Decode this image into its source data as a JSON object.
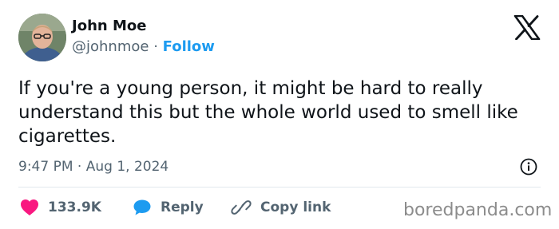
{
  "author": {
    "name": "John Moe",
    "handle": "@johnmoe",
    "separator": "·",
    "follow_label": "Follow"
  },
  "tweet": {
    "text": "If you're a young person, it might be hard to really understand this but the whole world used to smell like cigarettes.",
    "time": "9:47 PM",
    "date_separator": "·",
    "date": "Aug 1, 2024"
  },
  "actions": {
    "like_count": "133.9K",
    "reply_label": "Reply",
    "copy_label": "Copy link"
  },
  "watermark": "boredpanda.com",
  "icons": {
    "platform": "x-logo-icon",
    "info": "info-icon",
    "like": "heart-icon",
    "reply": "speech-bubble-icon",
    "copy": "link-icon"
  },
  "colors": {
    "accent": "#1d9bf0",
    "like": "#f91880",
    "secondary_text": "#536471"
  }
}
